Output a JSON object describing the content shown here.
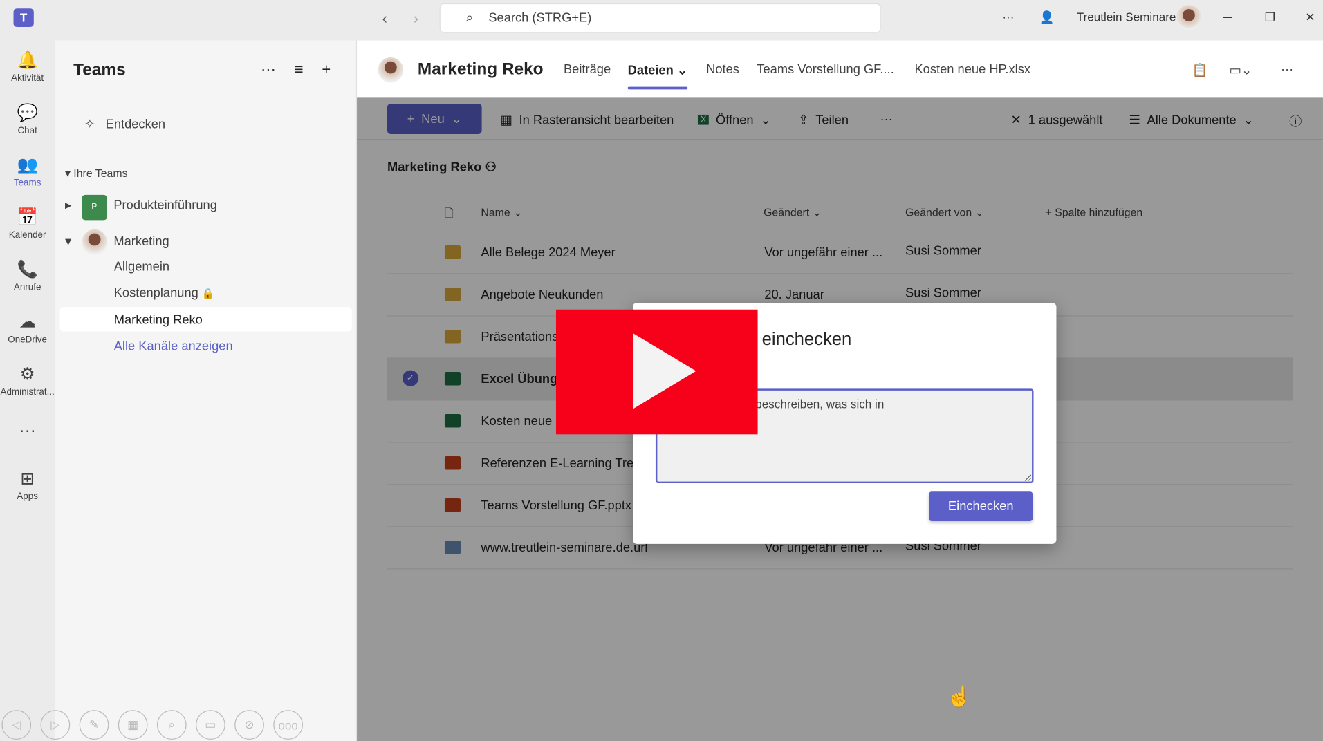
{
  "topbar": {
    "search_placeholder": "Search (STRG+E)",
    "user": "Treutlein Seminare"
  },
  "rail": [
    {
      "label": "Aktivität",
      "icon": "bell-icon",
      "glyph": "🔔"
    },
    {
      "label": "Chat",
      "icon": "chat-icon",
      "glyph": "💬"
    },
    {
      "label": "Teams",
      "icon": "teams-icon",
      "glyph": "👥"
    },
    {
      "label": "Kalender",
      "icon": "calendar-icon",
      "glyph": "📅"
    },
    {
      "label": "Anrufe",
      "icon": "phone-icon",
      "glyph": "📞"
    },
    {
      "label": "OneDrive",
      "icon": "cloud-icon",
      "glyph": "☁"
    },
    {
      "label": "Administrat...",
      "icon": "admin-icon",
      "glyph": "⚙"
    },
    {
      "label": "",
      "icon": "more-icon",
      "glyph": "···"
    },
    {
      "label": "Apps",
      "icon": "apps-icon",
      "glyph": "⊞"
    }
  ],
  "sidebar": {
    "title": "Teams",
    "discover": "Entdecken",
    "section": "Ihre Teams",
    "teams": [
      {
        "name": "Produkteinführung",
        "initial": "P"
      },
      {
        "name": "Marketing"
      }
    ],
    "channels": [
      "Allgemein",
      "Kostenplanung",
      "Marketing Reko"
    ],
    "all_channels": "Alle Kanäle anzeigen"
  },
  "header": {
    "title": "Marketing Reko",
    "tabs": [
      "Beiträge",
      "Dateien",
      "Notes",
      "Teams Vorstellung GF....",
      "Kosten neue HP.xlsx"
    ]
  },
  "toolbar": {
    "new": "Neu",
    "grid": "In Rasteransicht bearbeiten",
    "open": "Öffnen",
    "share": "Teilen",
    "selected": "1 ausgewählt",
    "view": "Alle Dokumente"
  },
  "library": {
    "title": "Marketing Reko",
    "columns": [
      "Name",
      "Geändert",
      "Geändert von",
      "Spalte hinzufügen"
    ],
    "rows": [
      {
        "name": "Alle Belege 2024 Meyer",
        "modified": "Vor ungefähr einer ...",
        "by": "Susi Sommer",
        "type": "folder"
      },
      {
        "name": "Angebote Neukunden",
        "modified": "20. Januar",
        "by": "Susi Sommer",
        "type": "folder"
      },
      {
        "name": "Präsentations",
        "modified": "",
        "by": "",
        "type": "folder"
      },
      {
        "name": "Excel Übung",
        "modified": "",
        "by": "",
        "type": "xlsx",
        "selected": true
      },
      {
        "name": "Kosten neue",
        "modified": "",
        "by": "",
        "type": "xlsx"
      },
      {
        "name": "Referenzen E-Learning Tre",
        "modified": "",
        "by": "",
        "type": "pdf"
      },
      {
        "name": "Teams Vorstellung GF.pptx",
        "modified": "",
        "by": "",
        "type": "pptx"
      },
      {
        "name": "www.treutlein-seminare.de.url",
        "modified": "Vor ungefähr einer ...",
        "by": "Susi Sommer",
        "type": "url"
      }
    ]
  },
  "dialog": {
    "title": "gsdatei.xlsx\" einchecken",
    "comment": "mentare ein, die beschreiben, was sich in\ngeändert hat.",
    "button": "Einchecken"
  },
  "colors": {
    "accent": "#5b5fc7",
    "youtube": "#f70019"
  }
}
